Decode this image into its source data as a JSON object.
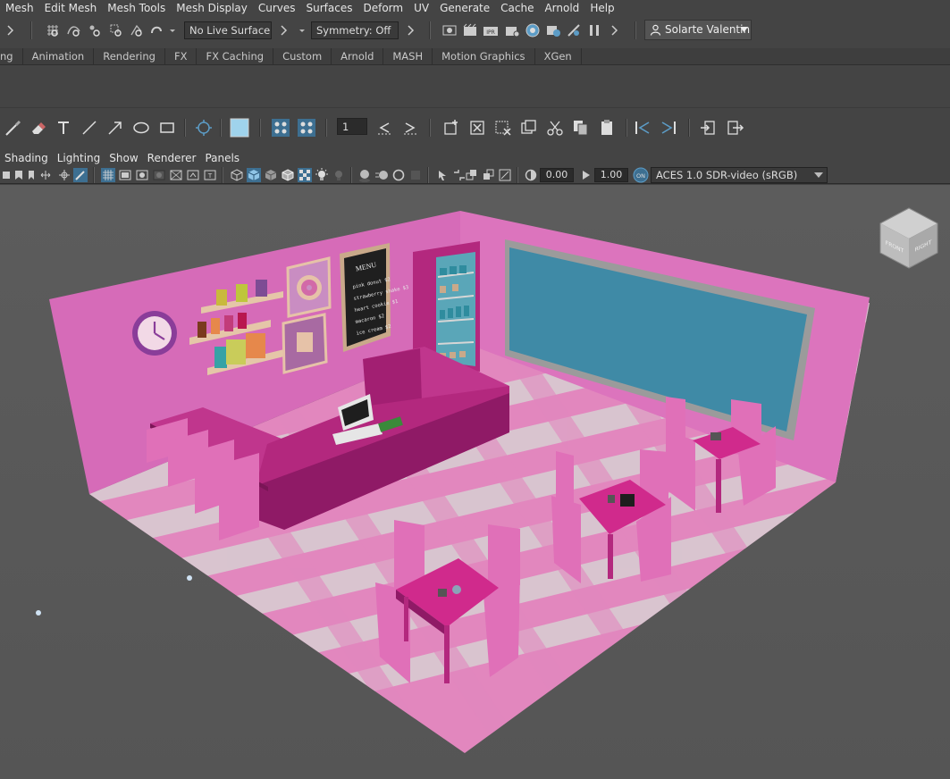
{
  "menubar": {
    "items": [
      "Mesh",
      "Edit Mesh",
      "Mesh Tools",
      "Mesh Display",
      "Curves",
      "Surfaces",
      "Deform",
      "UV",
      "Generate",
      "Cache",
      "Arnold",
      "Help"
    ]
  },
  "statusline": {
    "live_surface": "No Live Surface",
    "symmetry": "Symmetry: Off",
    "account": "Solarte Valentin"
  },
  "shelf": {
    "tabs": [
      "ng",
      "Animation",
      "Rendering",
      "FX",
      "FX Caching",
      "Custom",
      "Arnold",
      "MASH",
      "Motion Graphics",
      "XGen"
    ]
  },
  "tools": {
    "frame_value": "1"
  },
  "panel": {
    "menu": [
      "Shading",
      "Lighting",
      "Show",
      "Renderer",
      "Panels"
    ],
    "exposure": "0.00",
    "gamma": "1.00",
    "color_space": "ACES 1.0 SDR-video (sRGB)"
  },
  "viewcube": {
    "front": "FRONT",
    "right": "RIGHT"
  },
  "scene": {
    "menu_board_title": "MENU",
    "menu_board_lines": [
      "pink donut $2",
      "strawberry shake $3",
      "heart cookie $1",
      "macaron $2",
      "ice cream $2"
    ]
  },
  "colors": {
    "accent": "#5c9cc6",
    "wall": "#d66bb8",
    "counter": "#b3287e",
    "chair": "#e070b8",
    "floor_light": "#c8c0c4",
    "floor_pink": "#e287be",
    "window": "#3f8aa6"
  }
}
